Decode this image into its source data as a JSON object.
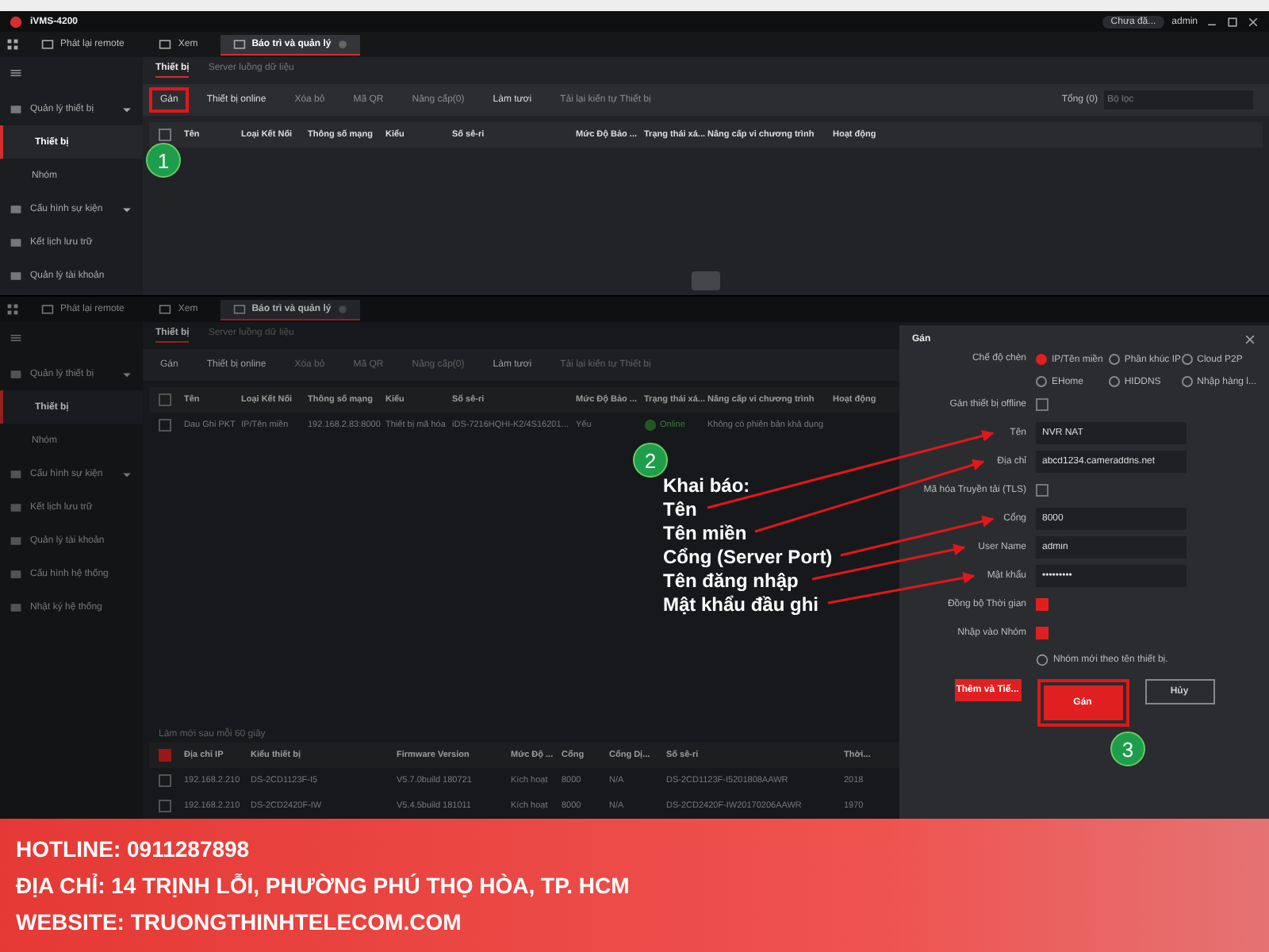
{
  "top_screenshot": {
    "app_title": "iVMS-4200",
    "tabs": [
      {
        "label": "Phát lại remote",
        "selected": false
      },
      {
        "label": "Xem",
        "selected": false
      },
      {
        "label": "Báo trì và quản lý",
        "selected": true
      }
    ],
    "cloud_status": "Chưa đă...",
    "user": "admin",
    "sidebar": [
      {
        "label": "Quản lý thiết bị",
        "kind": "group",
        "selected": false
      },
      {
        "label": "Thiết bị",
        "kind": "item",
        "selected": true
      },
      {
        "label": "Nhóm",
        "kind": "item",
        "selected": false
      },
      {
        "label": "Cấu hình sự kiện",
        "kind": "group",
        "selected": false
      },
      {
        "label": "Kết lịch lưu trữ",
        "kind": "section",
        "selected": false
      },
      {
        "label": "Quản lý tài khoản",
        "kind": "section",
        "selected": false
      }
    ],
    "subtabs": [
      {
        "label": "Thiết bị",
        "selected": true
      },
      {
        "label": "Server luồng dữ liệu",
        "selected": false
      }
    ],
    "toolbar": [
      {
        "label": "Gán",
        "disabled": false,
        "highlighted": true
      },
      {
        "label": "Thiết bị online",
        "disabled": false,
        "highlighted": false
      },
      {
        "label": "Xóa bỏ",
        "disabled": true,
        "highlighted": false
      },
      {
        "label": "Mã QR",
        "disabled": true,
        "highlighted": false
      },
      {
        "label": "Nâng cấp(0)",
        "disabled": true,
        "highlighted": false
      },
      {
        "label": "Làm tươi",
        "disabled": false,
        "highlighted": false
      },
      {
        "label": "Tải lại kiến tự Thiết bị",
        "disabled": true,
        "highlighted": false
      }
    ],
    "total": "Tổng (0)",
    "search_placeholder": "Bộ lọc",
    "select_all_checked": false,
    "columns": [
      "Tên",
      "Loại Kết Nối",
      "Thông số mạng",
      "Kiểu",
      "Số sê-ri",
      "Mức Độ Bảo ...",
      "Trạng thái xá...",
      "Nâng cấp vi chương trình",
      "Hoạt động"
    ],
    "step": "1"
  },
  "bottom_screenshot": {
    "tabs": [
      {
        "label": "Phát lại remote",
        "selected": false
      },
      {
        "label": "Xem",
        "selected": false
      },
      {
        "label": "Báo trì và quản lý",
        "selected": true
      }
    ],
    "sidebar": [
      {
        "label": "Quản lý thiết bị",
        "kind": "group",
        "selected": false
      },
      {
        "label": "Thiết bị",
        "kind": "item",
        "selected": true
      },
      {
        "label": "Nhóm",
        "kind": "item",
        "selected": false
      },
      {
        "label": "Cấu hình sự kiện",
        "kind": "group",
        "selected": false
      },
      {
        "label": "Kết lịch lưu trữ",
        "kind": "section",
        "selected": false
      },
      {
        "label": "Quản lý tài khoản",
        "kind": "section",
        "selected": false
      },
      {
        "label": "Cấu hình hệ thống",
        "kind": "section",
        "selected": false
      },
      {
        "label": "Nhật ký hệ thống",
        "kind": "section",
        "selected": false
      }
    ],
    "subtabs": [
      {
        "label": "Thiết bị",
        "selected": true
      },
      {
        "label": "Server luồng dữ liệu",
        "selected": false
      }
    ],
    "toolbar": [
      {
        "label": "Gán",
        "disabled": false
      },
      {
        "label": "Thiết bị online",
        "disabled": false
      },
      {
        "label": "Xóa bỏ",
        "disabled": true
      },
      {
        "label": "Mã QR",
        "disabled": true
      },
      {
        "label": "Nâng cấp(0)",
        "disabled": true
      },
      {
        "label": "Làm tươi",
        "disabled": false
      },
      {
        "label": "Tải lại kiến tự Thiết bị",
        "disabled": true
      }
    ],
    "columns": [
      "Tên",
      "Loại Kết Nối",
      "Thông số mạng",
      "Kiểu",
      "Số sê-ri",
      "Mức Độ Bảo ...",
      "Trạng thái xá...",
      "Nâng cấp vi chương trình",
      "Hoạt động"
    ],
    "select_all_checked": false,
    "rows": [
      {
        "checked": false,
        "cells": [
          "Dau Ghi PKT",
          "IP/Tên miền",
          "192.168.2.83:8000",
          "Thiết bị mã hóa",
          "iDS-7216HQHI-K2/4S16201...",
          "Yếu"
        ],
        "status": "Online",
        "online": true,
        "firmware": "Không có phiên bản khả dụng"
      }
    ],
    "refresh_label": "Làm mới sau mỗi 60 giây",
    "lower_select_all_checked": true,
    "lower_columns": [
      "Địa chỉ IP",
      "Kiểu thiết bị",
      "Firmware Version",
      "Mức Độ ...",
      "Cổng",
      "Cổng Dị...",
      "Số sê-ri",
      "Thời..."
    ],
    "lower_rows": [
      {
        "checked": false,
        "cells": [
          "192.168.2.210",
          "DS-2CD1123F-I5",
          "V5.7.0build 180721",
          "Kích hoạt",
          "8000",
          "N/A",
          "DS-2CD1123F-I5201808AAWR",
          "2018"
        ]
      },
      {
        "checked": false,
        "cells": [
          "192.168.2.210",
          "DS-2CD2420F-IW",
          "V5.4.5build 181011",
          "Kích hoạt",
          "8000",
          "N/A",
          "DS-2CD2420F-IW20170206AAWR",
          "1970"
        ]
      }
    ],
    "dialog": {
      "title": "Gán",
      "mode_label": "Chế độ chèn",
      "modes": [
        {
          "label": "IP/Tên miền",
          "selected": true
        },
        {
          "label": "Phân khúc IP",
          "selected": false
        },
        {
          "label": "Cloud P2P",
          "selected": false
        },
        {
          "label": "EHome",
          "selected": false
        },
        {
          "label": "HIDDNS",
          "selected": false
        },
        {
          "label": "Nhập hàng l...",
          "selected": false
        }
      ],
      "fields": [
        {
          "kind": "checkbox",
          "label": "Gán thiết bị offline",
          "checked": false
        },
        {
          "kind": "text",
          "label": "Tên",
          "value": "NVR NAT"
        },
        {
          "kind": "text",
          "label": "Địa chỉ",
          "value": "abcd1234.cameraddns.net"
        },
        {
          "kind": "checkbox",
          "label": "Mã hóa Truyền tải (TLS)",
          "checked": false
        },
        {
          "kind": "text",
          "label": "Cổng",
          "value": "8000"
        },
        {
          "kind": "text",
          "label": "User Name",
          "value": "admin"
        },
        {
          "kind": "password",
          "label": "Mật khẩu",
          "value": "•••••••••"
        },
        {
          "kind": "checkbox",
          "label": "Đồng bộ Thời gian",
          "checked": true
        },
        {
          "kind": "checkbox",
          "label": "Nhập vào Nhóm",
          "checked": true
        }
      ],
      "hint": "Nhóm mới theo tên thiết bị.",
      "buttons": [
        {
          "label": "Thêm và Tiế...",
          "kind": "primary",
          "highlighted": false
        },
        {
          "label": "Gán",
          "kind": "primary",
          "highlighted": true
        },
        {
          "label": "Hủy",
          "kind": "secondary",
          "highlighted": false
        }
      ]
    },
    "annotation": {
      "title": "Khai báo:",
      "lines": [
        "Tên",
        "Tên miền",
        "Cổng (Server Port)",
        "Tên đăng nhập",
        "Mật khẩu đầu ghi"
      ]
    },
    "steps": [
      "2",
      "3"
    ]
  },
  "footer": {
    "hotline": "HOTLINE: 0911287898",
    "address": "ĐỊA CHỈ: 14 TRỊNH LỖI, PHƯỜNG PHÚ THỌ HÒA, TP. HCM",
    "website": "WEBSITE: TRUONGTHINHTELECOM.COM"
  }
}
